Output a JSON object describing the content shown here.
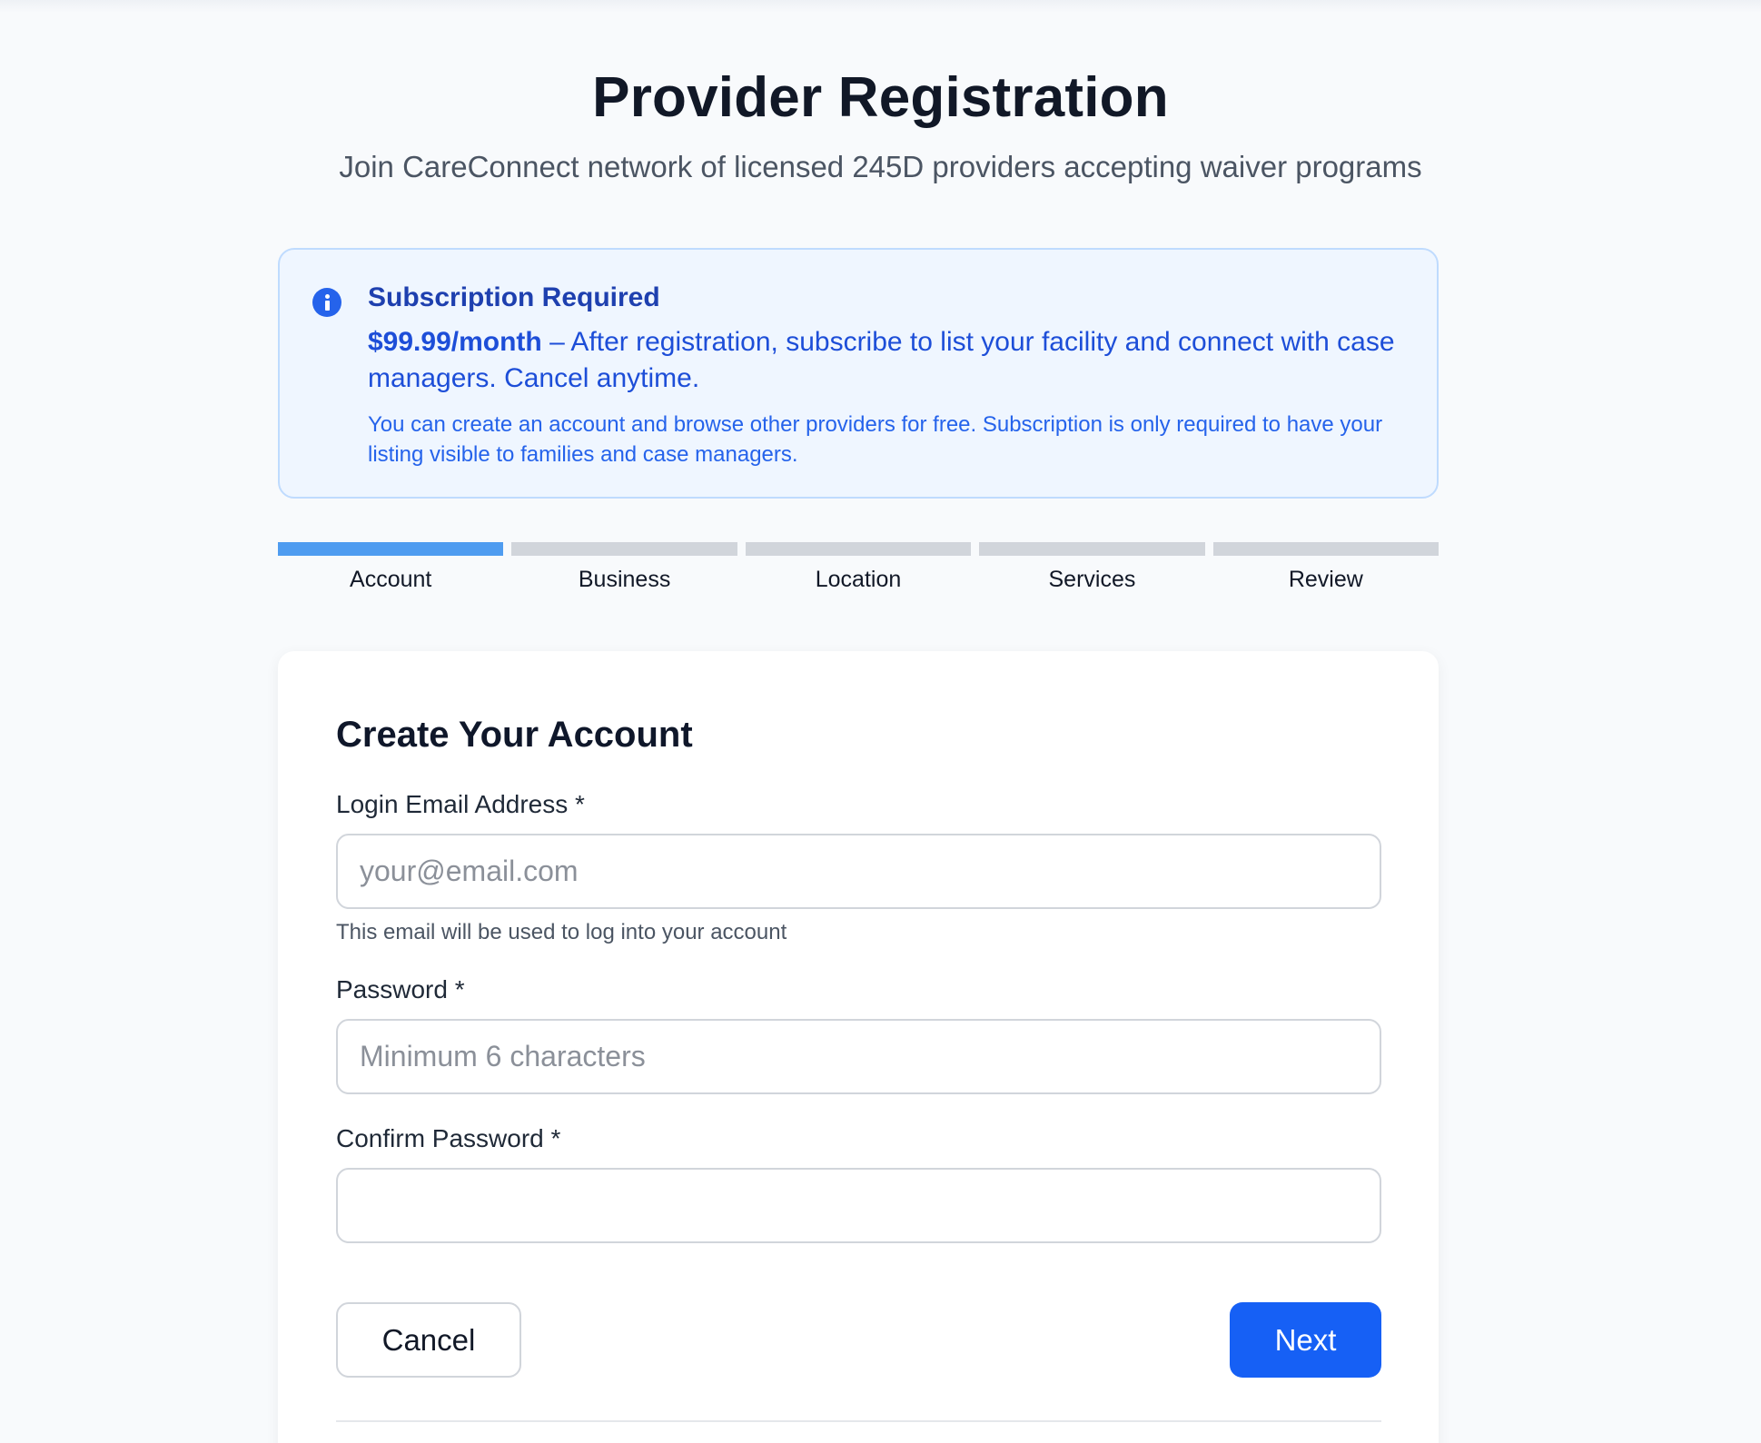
{
  "header": {
    "title": "Provider Registration",
    "subtitle": "Join CareConnect network of licensed 245D providers accepting waiver programs"
  },
  "notice": {
    "icon": "info-icon",
    "title": "Subscription Required",
    "price": "$99.99/month",
    "body": " – After registration, subscribe to list your facility and connect with case managers. Cancel anytime.",
    "note": "You can create an account and browse other providers for free. Subscription is only required to have your listing visible to families and case managers."
  },
  "steps": [
    {
      "label": "Account",
      "active": true
    },
    {
      "label": "Business",
      "active": false
    },
    {
      "label": "Location",
      "active": false
    },
    {
      "label": "Services",
      "active": false
    },
    {
      "label": "Review",
      "active": false
    }
  ],
  "form": {
    "title": "Create Your Account",
    "email": {
      "label": "Login Email Address *",
      "placeholder": "your@email.com",
      "value": "",
      "help": "This email will be used to log into your account"
    },
    "password": {
      "label": "Password *",
      "placeholder": "Minimum 6 characters",
      "value": ""
    },
    "confirm_password": {
      "label": "Confirm Password *",
      "placeholder": "",
      "value": ""
    },
    "cancel_label": "Cancel",
    "next_label": "Next"
  },
  "colors": {
    "accent": "#1660f5",
    "progress_active": "#4f9cf0",
    "progress_inactive": "#d1d5db",
    "notice_bg": "#eff6ff",
    "notice_text": "#1d4ed8"
  }
}
